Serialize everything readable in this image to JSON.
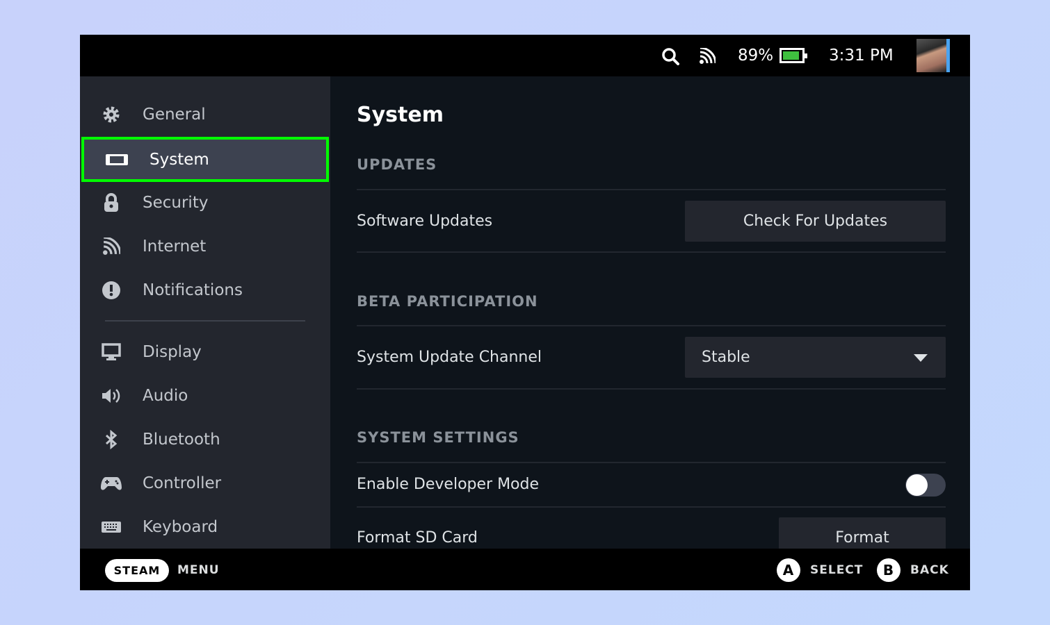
{
  "topbar": {
    "battery": "89%",
    "battery_level": 0.89,
    "time": "3:31 PM",
    "icons": [
      "search-icon",
      "wifi-icon",
      "battery-icon",
      "avatar"
    ]
  },
  "sidebar": {
    "items": [
      {
        "label": "General",
        "icon": "gear-icon"
      },
      {
        "label": "System",
        "icon": "handheld-icon",
        "selected": true
      },
      {
        "label": "Security",
        "icon": "lock-icon"
      },
      {
        "label": "Internet",
        "icon": "wifi-icon"
      },
      {
        "label": "Notifications",
        "icon": "alert-icon"
      },
      {
        "label": "Display",
        "icon": "monitor-icon"
      },
      {
        "label": "Audio",
        "icon": "speaker-icon"
      },
      {
        "label": "Bluetooth",
        "icon": "bluetooth-icon"
      },
      {
        "label": "Controller",
        "icon": "gamepad-icon"
      },
      {
        "label": "Keyboard",
        "icon": "keyboard-icon"
      }
    ]
  },
  "main": {
    "title": "System",
    "updates": {
      "heading": "UPDATES",
      "label": "Software Updates",
      "button": "Check For Updates"
    },
    "beta": {
      "heading": "BETA PARTICIPATION",
      "label": "System Update Channel",
      "value": "Stable"
    },
    "settings": {
      "heading": "SYSTEM SETTINGS",
      "dev_label": "Enable Developer Mode",
      "dev_enabled": false,
      "sd_label": "Format SD Card",
      "sd_button": "Format"
    }
  },
  "bottombar": {
    "steam": "STEAM",
    "menu": "MENU",
    "a": "A",
    "select": "SELECT",
    "b": "B",
    "back": "BACK"
  },
  "colors": {
    "highlight": "#00ff00",
    "battery": "#3fbf3f"
  }
}
